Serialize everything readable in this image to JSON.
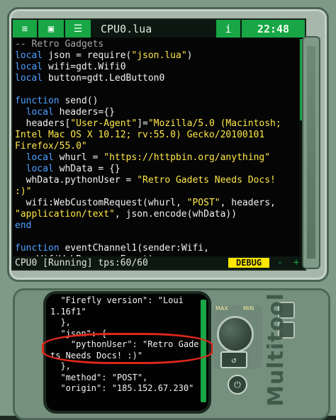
{
  "titlebar": {
    "tabs": [
      {
        "label": "≡",
        "icon": "menu-icon"
      },
      {
        "label": "▣",
        "icon": "gamepad-icon"
      },
      {
        "label": "☰",
        "icon": "document-icon"
      }
    ],
    "file_name": "CPU0.lua",
    "info_label": "i",
    "time": "22:48"
  },
  "code_lines": [
    [
      {
        "t": "-- Retro Gadgets",
        "c": "cmt"
      }
    ],
    [
      {
        "t": "local ",
        "c": "kw"
      },
      {
        "t": "json = require(",
        "c": "txt"
      },
      {
        "t": "\"json.lua\"",
        "c": "str"
      },
      {
        "t": ")",
        "c": "txt"
      }
    ],
    [
      {
        "t": "local ",
        "c": "kw"
      },
      {
        "t": "wifi=gdt.Wifi0",
        "c": "txt"
      }
    ],
    [
      {
        "t": "local ",
        "c": "kw"
      },
      {
        "t": "button=gdt.LedButton0",
        "c": "txt"
      }
    ],
    [
      {
        "t": "",
        "c": "txt"
      }
    ],
    [
      {
        "t": "function ",
        "c": "kw"
      },
      {
        "t": "send()",
        "c": "txt"
      }
    ],
    [
      {
        "t": "  local ",
        "c": "kw"
      },
      {
        "t": "headers={}",
        "c": "txt"
      }
    ],
    [
      {
        "t": "  headers[",
        "c": "txt"
      },
      {
        "t": "\"User-Agent\"",
        "c": "str"
      },
      {
        "t": "]=",
        "c": "txt"
      },
      {
        "t": "\"Mozilla/5.0 (Macintosh;",
        "c": "str"
      }
    ],
    [
      {
        "t": "Intel Mac OS X 10.12; rv:55.0) Gecko/20100101",
        "c": "str"
      }
    ],
    [
      {
        "t": "Firefox/55.0\"",
        "c": "str"
      }
    ],
    [
      {
        "t": "  local ",
        "c": "kw"
      },
      {
        "t": "whurl = ",
        "c": "txt"
      },
      {
        "t": "\"https://httpbin.org/anything\"",
        "c": "str"
      }
    ],
    [
      {
        "t": "  local ",
        "c": "kw"
      },
      {
        "t": "whData = {}",
        "c": "txt"
      }
    ],
    [
      {
        "t": "  whData.pythonUser = ",
        "c": "txt"
      },
      {
        "t": "\"Retro Gadets Needs Docs!",
        "c": "str"
      }
    ],
    [
      {
        "t": ":)\"",
        "c": "str"
      }
    ],
    [
      {
        "t": "  wifi:WebCustomRequest(whurl, ",
        "c": "txt"
      },
      {
        "t": "\"POST\"",
        "c": "str"
      },
      {
        "t": ", headers,",
        "c": "txt"
      }
    ],
    [
      {
        "t": "\"application/text\"",
        "c": "str"
      },
      {
        "t": ", json.encode(whData))",
        "c": "txt"
      }
    ],
    [
      {
        "t": "end",
        "c": "kw"
      }
    ],
    [
      {
        "t": "",
        "c": "txt"
      }
    ],
    [
      {
        "t": "function ",
        "c": "kw"
      },
      {
        "t": "eventChannel1(sender:Wifi,",
        "c": "txt"
      }
    ],
    [
      {
        "t": "arg:WifiWebResponseEvent)",
        "c": "txt"
      }
    ]
  ],
  "status": {
    "text": "CPU0 [Running] tps:60/60",
    "debug_label": "DEBUG",
    "minus_label": "-",
    "plus_label": "+"
  },
  "monitor": {
    "lines": [
      "  \"Firefly version\": \"Loui",
      "1.16f1\"",
      "  },",
      "  \"json\": {",
      "    \"pythonUser\": \"Retro Gade",
      "ts Needs Docs! :)\"",
      "  },",
      "  \"method\": \"POST\",",
      "  \"origin\": \"185.152.67.230\""
    ]
  },
  "controls": {
    "mute_label": "MAX",
    "min_label": "MIN",
    "reset_label": "↺",
    "power_label": "⏻",
    "brand": "Multitool"
  },
  "colors": {
    "accent_green": "#18a646",
    "keyword_blue": "#4ca0ff",
    "string_yellow": "#ffe84a",
    "comment_gray": "#a8a8a8",
    "annotation_red": "#e0271c"
  }
}
